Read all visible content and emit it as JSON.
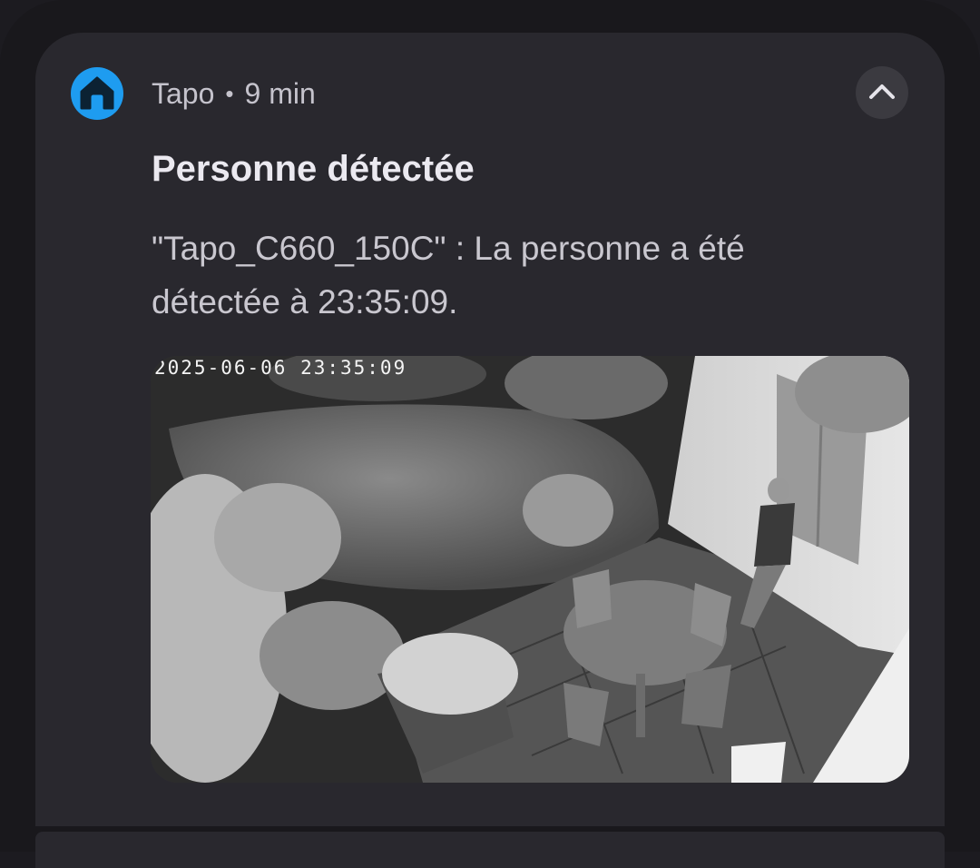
{
  "notification": {
    "app_name": "Tapo",
    "separator": "•",
    "time_ago": "9 min",
    "app_icon": "home-icon",
    "app_icon_color": "#1e9cf0",
    "collapse_icon": "chevron-up-icon",
    "title": "Personne détectée",
    "message": "\"Tapo_C660_150C\" : La personne a été détectée à 23:35:09.",
    "snapshot": {
      "timestamp": "2025-06-06 23:35:09",
      "description_icon": "camera-snapshot"
    }
  }
}
